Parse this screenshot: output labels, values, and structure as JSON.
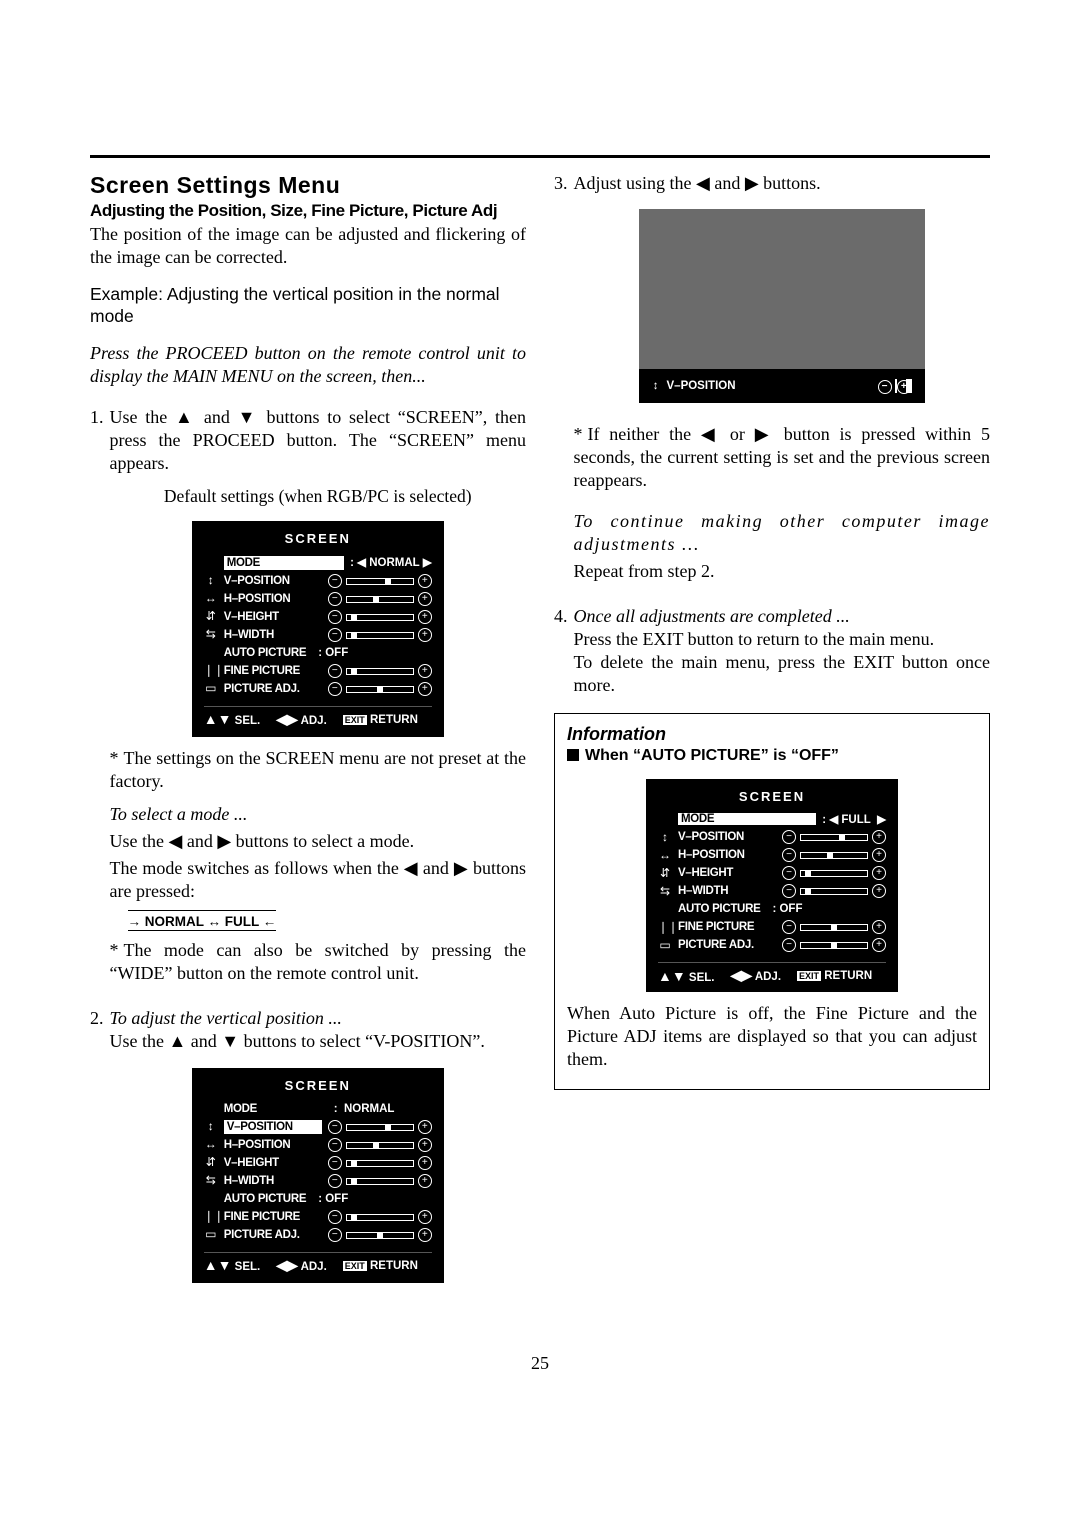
{
  "page_number": "25",
  "heading": "Screen Settings Menu",
  "subtitle": "Adjusting the Position, Size, Fine Picture, Picture Adj",
  "intro1": "The position of the image can be adjusted and flickering of the image can be corrected.",
  "example": "Example: Adjusting the vertical position in the normal mode",
  "press_proceed": "Press the PROCEED button on the remote control unit to display the MAIN MENU on the screen, then...",
  "step1": {
    "num": "1.",
    "text": "Use the ▲ and ▼ buttons to select “SCREEN”, then press the PROCEED button. The “SCREEN” menu appears.",
    "caption": "Default settings (when RGB/PC is selected)"
  },
  "osd_a": {
    "title": "SCREEN",
    "mode_label": "MODE",
    "mode_value": "NORMAL",
    "rows": [
      {
        "icon": "↕",
        "label": "V–POSITION",
        "thumb": 38
      },
      {
        "icon": "↔",
        "label": "H–POSITION",
        "thumb": 26
      },
      {
        "icon": "⇵",
        "label": "V–HEIGHT",
        "thumb": 4
      },
      {
        "icon": "⇆",
        "label": "H–WIDTH",
        "thumb": 4
      }
    ],
    "auto_label": "AUTO PICTURE",
    "auto_value": ":   OFF",
    "fine_label": "FINE PICTURE",
    "padj_label": "PICTURE ADJ.",
    "footer_sel": "SEL.",
    "footer_adj": "ADJ.",
    "footer_exit": "EXIT",
    "footer_return": "RETURN"
  },
  "note_factory": "The settings on the SCREEN menu are not preset at the factory.",
  "select_mode_h": "To select a mode ...",
  "select_mode_1": "Use the ◀ and ▶ buttons to select a mode.",
  "select_mode_2": "The mode switches as follows when the ◀ and ▶ buttons are pressed:",
  "cycle_text": "→ NORMAL ↔ FULL ←",
  "note_wide": "The mode can also be switched by pressing the “WIDE” button on the remote control unit.",
  "step2": {
    "num": "2.",
    "h": "To adjust the vertical position ...",
    "text": "Use the ▲ and ▼ buttons to select “V-POSITION”."
  },
  "osd_b_mode_value": "NORMAL",
  "step3": {
    "num": "3.",
    "text": "Adjust using the ◀ and ▶ buttons."
  },
  "osd_c_label": "V–POSITION",
  "note_5sec": "If neither the ◀ or ▶ button is pressed within 5 seconds, the current setting is set and the previous screen reappears.",
  "continue_h": "To continue making other computer image adjustments ...",
  "continue_t": "Repeat from step 2.",
  "step4": {
    "num": "4.",
    "h": "Once all adjustments are completed ...",
    "t1": "Press the EXIT button to return to the main menu.",
    "t2": "To delete the main menu, press the EXIT button once more."
  },
  "info": {
    "title": "Information",
    "sub": "When “AUTO PICTURE” is “OFF”",
    "mode_value": "FULL",
    "text": "When Auto Picture is off, the Fine Picture and the Picture ADJ items are displayed so that you can adjust them."
  }
}
